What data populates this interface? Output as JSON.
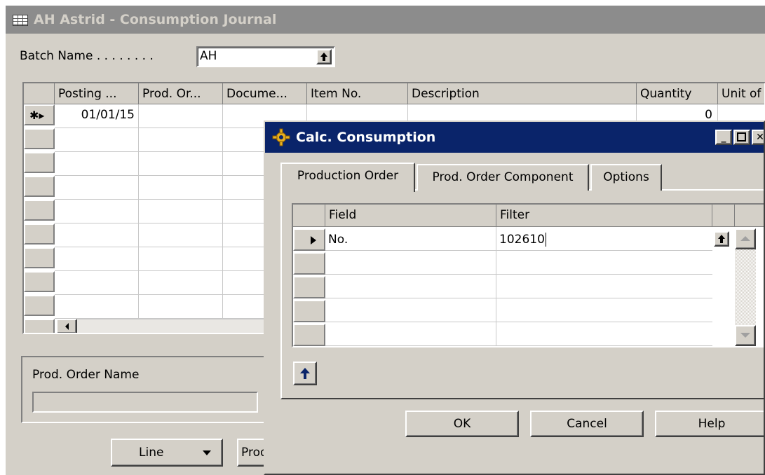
{
  "main_window": {
    "title": "AH Astrid - Consumption Journal",
    "batch_label": "Batch Name . . . . . . . .",
    "batch_value": "AH",
    "columns": [
      "Posting ...",
      "Prod. Or...",
      "Docume...",
      "Item No.",
      "Description",
      "Quantity",
      "Unit of"
    ],
    "first_row": {
      "posting_date": "01/01/15",
      "quantity": "0"
    },
    "prod_order_name_label": "Prod. Order Name",
    "buttons": {
      "line": "Line",
      "prod": "Prod"
    }
  },
  "dialog": {
    "title": "Calc. Consumption",
    "tabs": [
      "Production Order",
      "Prod. Order Component",
      "Options"
    ],
    "active_tab": "Production Order",
    "filter_columns": [
      "Field",
      "Filter"
    ],
    "filter_rows": [
      {
        "field": "No.",
        "filter": "102610"
      }
    ],
    "buttons": {
      "ok": "OK",
      "cancel": "Cancel",
      "help": "Help"
    }
  },
  "icons": [
    "table-icon",
    "gear-icon",
    "lookup-arrow-icon",
    "dropdown-arrow-icon",
    "scroll-left-icon",
    "scroll-up-icon",
    "scroll-down-icon",
    "row-pointer-icon",
    "new-row-icon",
    "minimize-icon",
    "maximize-icon",
    "close-icon"
  ],
  "colors": {
    "dialog_title_bar": "#0a246a",
    "inactive_title_bar": "#8c8c8c",
    "window_face": "#d4d0c8"
  }
}
